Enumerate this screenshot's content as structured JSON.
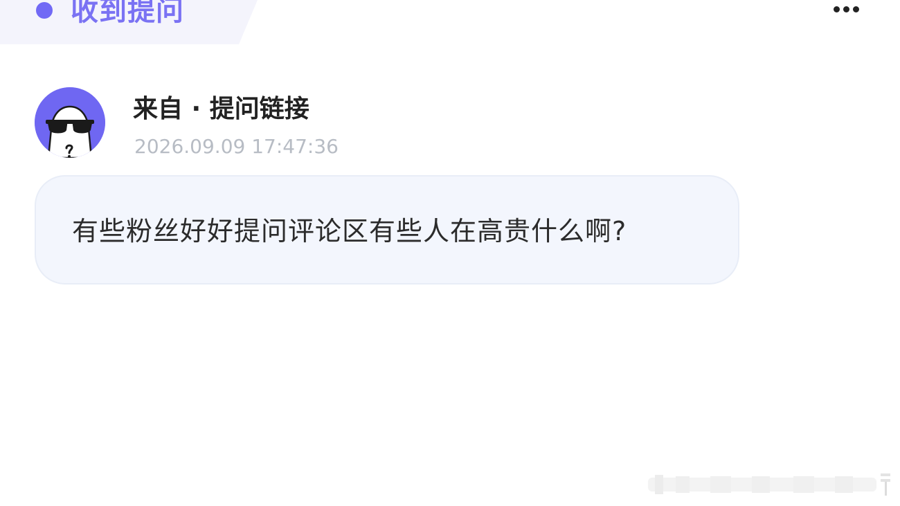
{
  "header": {
    "title": "收到提问",
    "accent_color": "#7169f5"
  },
  "menu": {
    "icon": "more-horizontal-icon"
  },
  "question": {
    "avatar_icon": "sunglasses-ghost-avatar",
    "from_label": "来自 · 提问链接",
    "timestamp": "2026.09.09 17:47:36",
    "text": "有些粉丝好好提问评论区有些人在高贵什么啊?"
  }
}
